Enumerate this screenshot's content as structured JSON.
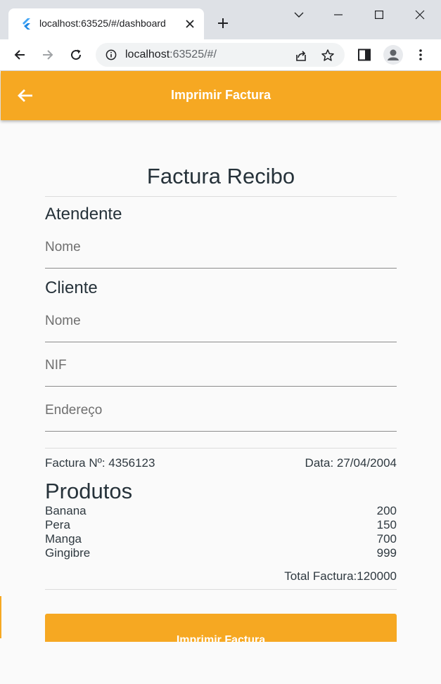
{
  "browser": {
    "tab_title": "localhost:63525/#/dashboard",
    "url_host": "localhost",
    "url_rest": ":63525/#/",
    "accent": "#f6a822"
  },
  "appbar": {
    "title": "Imprimir Factura",
    "back_icon": "arrow-left-icon"
  },
  "receipt": {
    "title": "Factura Recibo",
    "attendant": {
      "heading": "Atendente",
      "name_placeholder": "Nome"
    },
    "client": {
      "heading": "Cliente",
      "name_placeholder": "Nome",
      "nif_placeholder": "NIF",
      "address_placeholder": "Endereço"
    },
    "invoice_number": "Factura Nº: 4356123",
    "invoice_date": "Data: 27/04/2004",
    "products_heading": "Produtos",
    "products": [
      {
        "name": "Banana",
        "value": "200"
      },
      {
        "name": "Pera",
        "value": "150"
      },
      {
        "name": "Manga",
        "value": "700"
      },
      {
        "name": "Gingibre",
        "value": "999"
      }
    ],
    "total": "Total Factura:120000",
    "print_button": "Imprimir Factura"
  }
}
